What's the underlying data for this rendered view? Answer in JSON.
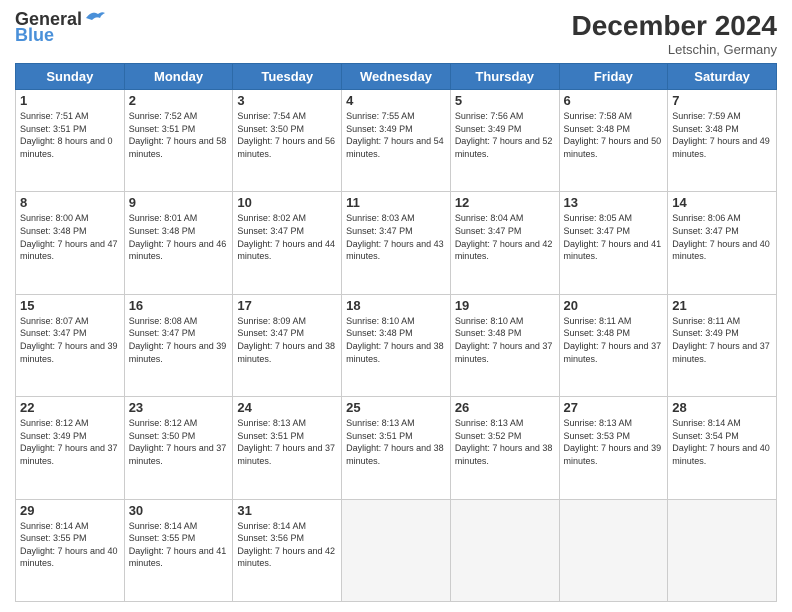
{
  "header": {
    "logo_line1": "General",
    "logo_line2": "Blue",
    "month": "December 2024",
    "location": "Letschin, Germany"
  },
  "days_of_week": [
    "Sunday",
    "Monday",
    "Tuesday",
    "Wednesday",
    "Thursday",
    "Friday",
    "Saturday"
  ],
  "weeks": [
    [
      {
        "day": "1",
        "sunrise": "7:51 AM",
        "sunset": "3:51 PM",
        "daylight": "8 hours and 0 minutes."
      },
      {
        "day": "2",
        "sunrise": "7:52 AM",
        "sunset": "3:51 PM",
        "daylight": "7 hours and 58 minutes."
      },
      {
        "day": "3",
        "sunrise": "7:54 AM",
        "sunset": "3:50 PM",
        "daylight": "7 hours and 56 minutes."
      },
      {
        "day": "4",
        "sunrise": "7:55 AM",
        "sunset": "3:49 PM",
        "daylight": "7 hours and 54 minutes."
      },
      {
        "day": "5",
        "sunrise": "7:56 AM",
        "sunset": "3:49 PM",
        "daylight": "7 hours and 52 minutes."
      },
      {
        "day": "6",
        "sunrise": "7:58 AM",
        "sunset": "3:48 PM",
        "daylight": "7 hours and 50 minutes."
      },
      {
        "day": "7",
        "sunrise": "7:59 AM",
        "sunset": "3:48 PM",
        "daylight": "7 hours and 49 minutes."
      }
    ],
    [
      {
        "day": "8",
        "sunrise": "8:00 AM",
        "sunset": "3:48 PM",
        "daylight": "7 hours and 47 minutes."
      },
      {
        "day": "9",
        "sunrise": "8:01 AM",
        "sunset": "3:48 PM",
        "daylight": "7 hours and 46 minutes."
      },
      {
        "day": "10",
        "sunrise": "8:02 AM",
        "sunset": "3:47 PM",
        "daylight": "7 hours and 44 minutes."
      },
      {
        "day": "11",
        "sunrise": "8:03 AM",
        "sunset": "3:47 PM",
        "daylight": "7 hours and 43 minutes."
      },
      {
        "day": "12",
        "sunrise": "8:04 AM",
        "sunset": "3:47 PM",
        "daylight": "7 hours and 42 minutes."
      },
      {
        "day": "13",
        "sunrise": "8:05 AM",
        "sunset": "3:47 PM",
        "daylight": "7 hours and 41 minutes."
      },
      {
        "day": "14",
        "sunrise": "8:06 AM",
        "sunset": "3:47 PM",
        "daylight": "7 hours and 40 minutes."
      }
    ],
    [
      {
        "day": "15",
        "sunrise": "8:07 AM",
        "sunset": "3:47 PM",
        "daylight": "7 hours and 39 minutes."
      },
      {
        "day": "16",
        "sunrise": "8:08 AM",
        "sunset": "3:47 PM",
        "daylight": "7 hours and 39 minutes."
      },
      {
        "day": "17",
        "sunrise": "8:09 AM",
        "sunset": "3:47 PM",
        "daylight": "7 hours and 38 minutes."
      },
      {
        "day": "18",
        "sunrise": "8:10 AM",
        "sunset": "3:48 PM",
        "daylight": "7 hours and 38 minutes."
      },
      {
        "day": "19",
        "sunrise": "8:10 AM",
        "sunset": "3:48 PM",
        "daylight": "7 hours and 37 minutes."
      },
      {
        "day": "20",
        "sunrise": "8:11 AM",
        "sunset": "3:48 PM",
        "daylight": "7 hours and 37 minutes."
      },
      {
        "day": "21",
        "sunrise": "8:11 AM",
        "sunset": "3:49 PM",
        "daylight": "7 hours and 37 minutes."
      }
    ],
    [
      {
        "day": "22",
        "sunrise": "8:12 AM",
        "sunset": "3:49 PM",
        "daylight": "7 hours and 37 minutes."
      },
      {
        "day": "23",
        "sunrise": "8:12 AM",
        "sunset": "3:50 PM",
        "daylight": "7 hours and 37 minutes."
      },
      {
        "day": "24",
        "sunrise": "8:13 AM",
        "sunset": "3:51 PM",
        "daylight": "7 hours and 37 minutes."
      },
      {
        "day": "25",
        "sunrise": "8:13 AM",
        "sunset": "3:51 PM",
        "daylight": "7 hours and 38 minutes."
      },
      {
        "day": "26",
        "sunrise": "8:13 AM",
        "sunset": "3:52 PM",
        "daylight": "7 hours and 38 minutes."
      },
      {
        "day": "27",
        "sunrise": "8:13 AM",
        "sunset": "3:53 PM",
        "daylight": "7 hours and 39 minutes."
      },
      {
        "day": "28",
        "sunrise": "8:14 AM",
        "sunset": "3:54 PM",
        "daylight": "7 hours and 40 minutes."
      }
    ],
    [
      {
        "day": "29",
        "sunrise": "8:14 AM",
        "sunset": "3:55 PM",
        "daylight": "7 hours and 40 minutes."
      },
      {
        "day": "30",
        "sunrise": "8:14 AM",
        "sunset": "3:55 PM",
        "daylight": "7 hours and 41 minutes."
      },
      {
        "day": "31",
        "sunrise": "8:14 AM",
        "sunset": "3:56 PM",
        "daylight": "7 hours and 42 minutes."
      },
      null,
      null,
      null,
      null
    ]
  ]
}
